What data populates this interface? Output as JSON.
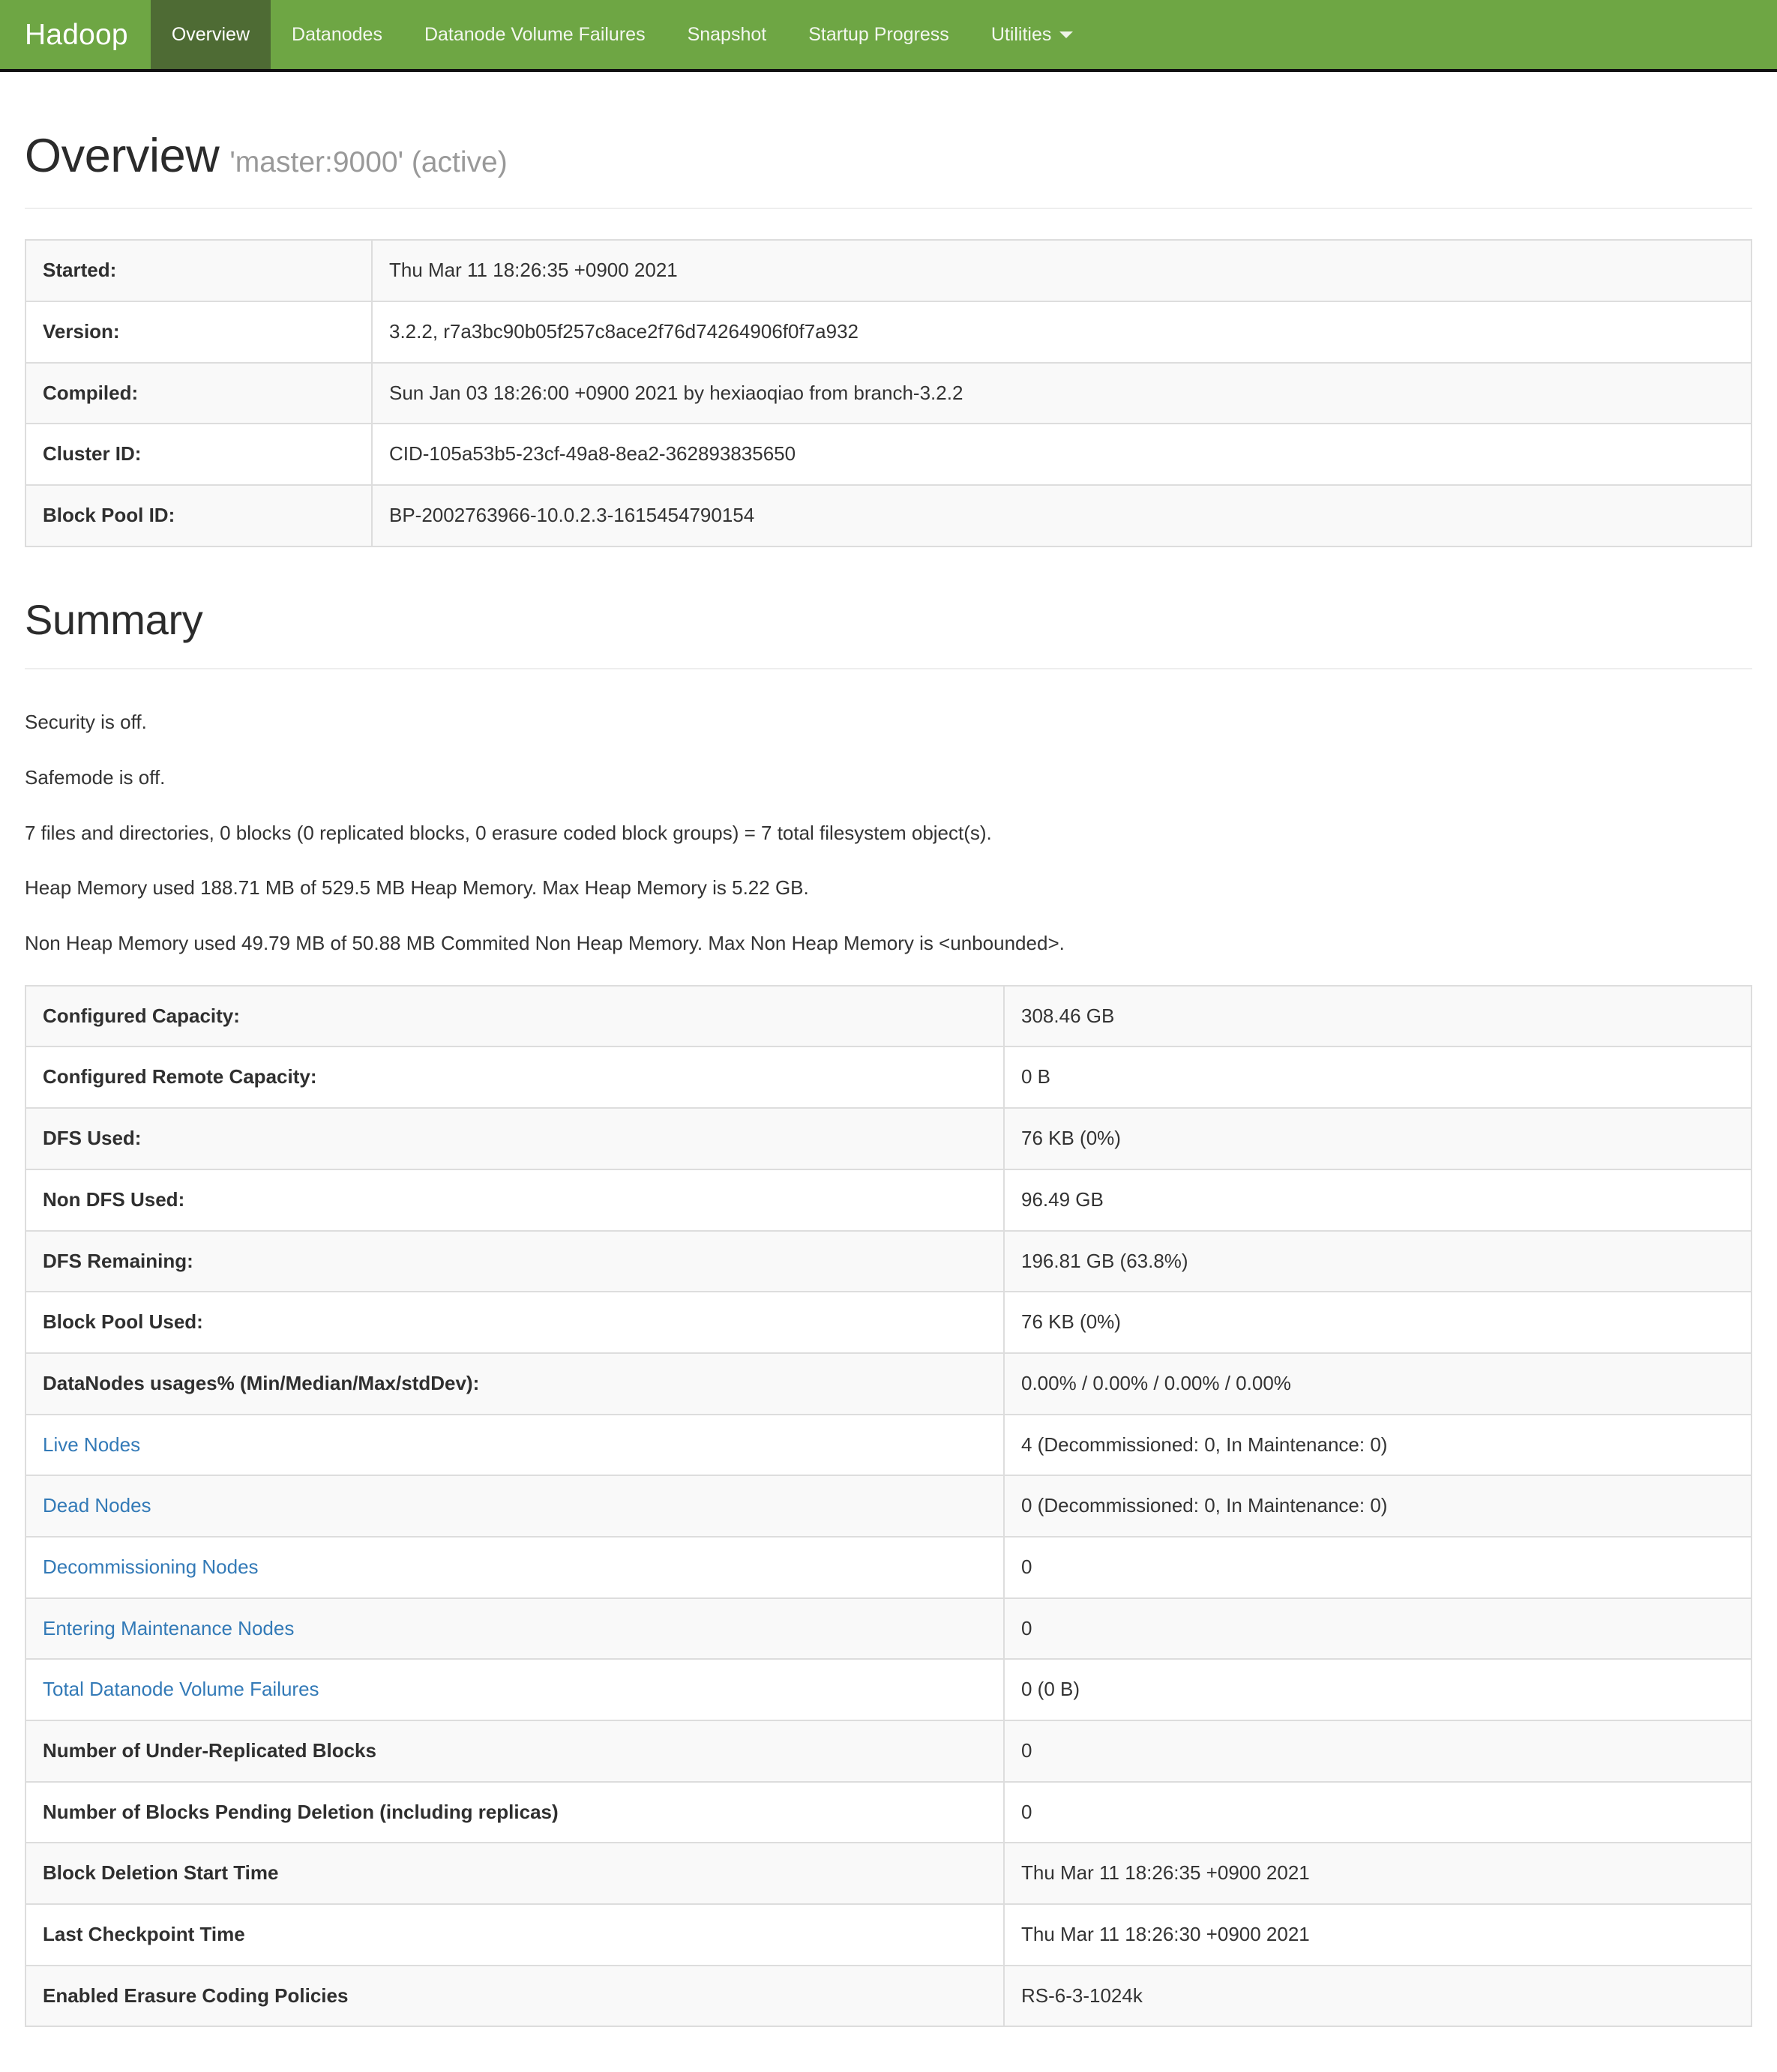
{
  "navbar": {
    "brand": "Hadoop",
    "items": [
      {
        "label": "Overview",
        "active": true,
        "caret": false
      },
      {
        "label": "Datanodes",
        "active": false,
        "caret": false
      },
      {
        "label": "Datanode Volume Failures",
        "active": false,
        "caret": false
      },
      {
        "label": "Snapshot",
        "active": false,
        "caret": false
      },
      {
        "label": "Startup Progress",
        "active": false,
        "caret": false
      },
      {
        "label": "Utilities",
        "active": false,
        "caret": true
      }
    ],
    "brand_color": "#6ea644",
    "active_color": "#4e6b34"
  },
  "overview": {
    "title": "Overview",
    "subtitle": "'master:9000' (active)",
    "rows": [
      {
        "key": "Started:",
        "value": "Thu Mar 11 18:26:35 +0900 2021"
      },
      {
        "key": "Version:",
        "value": "3.2.2, r7a3bc90b05f257c8ace2f76d74264906f0f7a932"
      },
      {
        "key": "Compiled:",
        "value": "Sun Jan 03 18:26:00 +0900 2021 by hexiaoqiao from branch-3.2.2"
      },
      {
        "key": "Cluster ID:",
        "value": "CID-105a53b5-23cf-49a8-8ea2-362893835650"
      },
      {
        "key": "Block Pool ID:",
        "value": "BP-2002763966-10.0.2.3-1615454790154"
      }
    ]
  },
  "summary": {
    "title": "Summary",
    "paragraphs": [
      "Security is off.",
      "Safemode is off.",
      "7 files and directories, 0 blocks (0 replicated blocks, 0 erasure coded block groups) = 7 total filesystem object(s).",
      "Heap Memory used 188.71 MB of 529.5 MB Heap Memory. Max Heap Memory is 5.22 GB.",
      "Non Heap Memory used 49.79 MB of 50.88 MB Commited Non Heap Memory. Max Non Heap Memory is <unbounded>."
    ],
    "rows": [
      {
        "key": "Configured Capacity:",
        "value": "308.46 GB",
        "link": false
      },
      {
        "key": "Configured Remote Capacity:",
        "value": "0 B",
        "link": false
      },
      {
        "key": "DFS Used:",
        "value": "76 KB (0%)",
        "link": false
      },
      {
        "key": "Non DFS Used:",
        "value": "96.49 GB",
        "link": false
      },
      {
        "key": "DFS Remaining:",
        "value": "196.81 GB (63.8%)",
        "link": false
      },
      {
        "key": "Block Pool Used:",
        "value": "76 KB (0%)",
        "link": false
      },
      {
        "key": "DataNodes usages% (Min/Median/Max/stdDev):",
        "value": "0.00% / 0.00% / 0.00% / 0.00%",
        "link": false
      },
      {
        "key": "Live Nodes",
        "value": "4 (Decommissioned: 0, In Maintenance: 0)",
        "link": true
      },
      {
        "key": "Dead Nodes",
        "value": "0 (Decommissioned: 0, In Maintenance: 0)",
        "link": true
      },
      {
        "key": "Decommissioning Nodes",
        "value": "0",
        "link": true
      },
      {
        "key": "Entering Maintenance Nodes",
        "value": "0",
        "link": true
      },
      {
        "key": "Total Datanode Volume Failures",
        "value": "0 (0 B)",
        "link": true
      },
      {
        "key": "Number of Under-Replicated Blocks",
        "value": "0",
        "link": false
      },
      {
        "key": "Number of Blocks Pending Deletion (including replicas)",
        "value": "0",
        "link": false
      },
      {
        "key": "Block Deletion Start Time",
        "value": "Thu Mar 11 18:26:35 +0900 2021",
        "link": false
      },
      {
        "key": "Last Checkpoint Time",
        "value": "Thu Mar 11 18:26:30 +0900 2021",
        "link": false
      },
      {
        "key": "Enabled Erasure Coding Policies",
        "value": "RS-6-3-1024k",
        "link": false
      }
    ],
    "link_color": "#337ab7"
  }
}
